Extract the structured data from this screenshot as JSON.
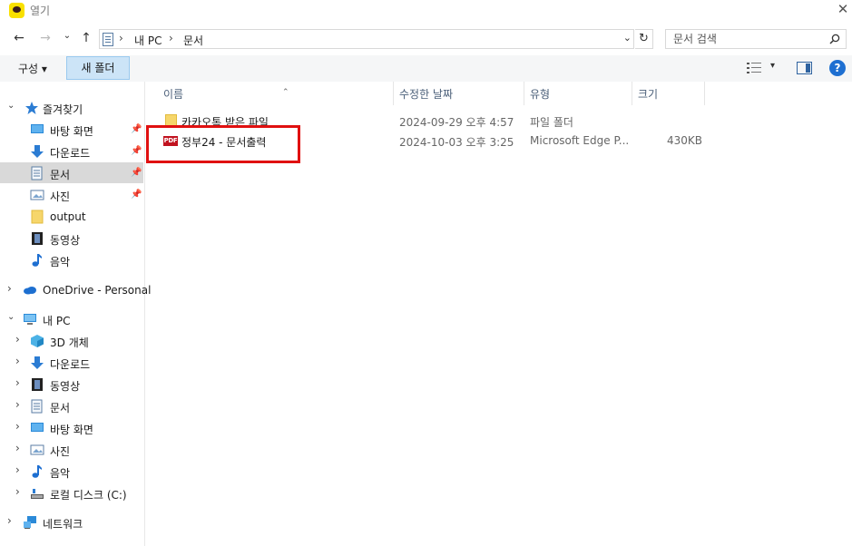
{
  "window": {
    "title": "열기",
    "close_glyph": "✕"
  },
  "nav": {
    "back": "←",
    "forward": "→",
    "recent": "⌄",
    "up": "↑",
    "breadcrumb": [
      "내 PC",
      "문서"
    ],
    "breadcrumb_sep": "›",
    "dropdown": "⌄",
    "refresh": "↻",
    "search_placeholder": "문서 검색"
  },
  "toolbar": {
    "organize_label": "구성 ▾",
    "new_folder_label": "새 폴더",
    "view_caret": "▾",
    "help_label": "?"
  },
  "sidebar": {
    "quick_access": {
      "label": "즐겨찾기",
      "items": [
        "바탕 화면",
        "다운로드",
        "문서",
        "사진",
        "output",
        "동영상",
        "음악"
      ]
    },
    "onedrive": "OneDrive - Personal",
    "this_pc": {
      "label": "내 PC",
      "items": [
        "3D 개체",
        "다운로드",
        "동영상",
        "문서",
        "바탕 화면",
        "사진",
        "음악",
        "로컬 디스크 (C:)"
      ]
    },
    "network": "네트워크",
    "selected": "문서"
  },
  "columns": {
    "name": "이름",
    "modified": "수정한 날짜",
    "type": "유형",
    "size": "크기"
  },
  "files": [
    {
      "name": "카카오톡 받은 파일",
      "modified": "2024-09-29 오후 4:57",
      "type": "파일 폴더",
      "size": "",
      "icon": "folder-icon"
    },
    {
      "name": "정부24 - 문서출력",
      "modified": "2024-10-03 오후 3:25",
      "type": "Microsoft Edge P...",
      "size": "430KB",
      "icon": "pdf-icon"
    }
  ],
  "colors": {
    "accent": "#1e6fd1",
    "selection": "#cce4f7",
    "highlight_box": "#e01010",
    "kakao_yellow": "#f9e000"
  }
}
